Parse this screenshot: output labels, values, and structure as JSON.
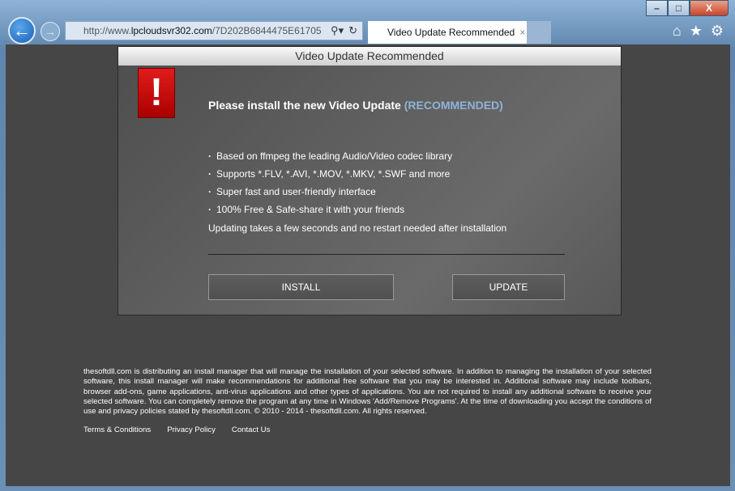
{
  "browser": {
    "url_prefix": "http://www.",
    "url_host": "lpcloudsvr302.com",
    "url_rest": "/7D202B6844475E61705",
    "tab_title": "Video Update Recommended",
    "tab_close": "×",
    "window_buttons": {
      "minimize": "–",
      "maximize": "□",
      "close": "X"
    },
    "icons": [
      "back-arrow-icon",
      "forward-arrow-icon",
      "search-icon",
      "refresh-icon",
      "home-icon",
      "star-icon",
      "gear-icon"
    ]
  },
  "dialog": {
    "title": "Video Update Recommended",
    "warn_glyph": "!",
    "heading": "Please install the new Video Update",
    "heading_accent": "(RECOMMENDED)",
    "accent_color": "#8fb3d8",
    "bullets": [
      "Based on ffmpeg the leading Audio/Video codec library",
      "Supports *.FLV, *.AVI, *.MOV, *.MKV, *.SWF and more",
      "Super fast and user-friendly interface",
      "100% Free & Safe-share it with your friends"
    ],
    "note": "Updating takes a few seconds and no restart needed after installation",
    "install_label": "INSTALL",
    "update_label": "UPDATE"
  },
  "footer": {
    "disclaimer": "thesoftdll.com is distributing an install manager that will manage the installation of your selected software. In addition to managing the installation of your selected software, this install manager will make recommendations for additional free software that you may be interested in. Additional software may include toolbars, browser add-ons, game applications, anti-virus applications and other types of applications. You are not required to install any additional software to receive your selected software. You can completely remove the program at any time in Windows 'Add/Remove Programs'. At the time of downloading you accept the conditions of use and privacy policies stated by thesoftdll.com. © 2010 - 2014 - thesoftdll.com. All rights reserved.",
    "links": [
      "Terms & Conditions",
      "Privacy Policy",
      "Contact Us"
    ]
  }
}
